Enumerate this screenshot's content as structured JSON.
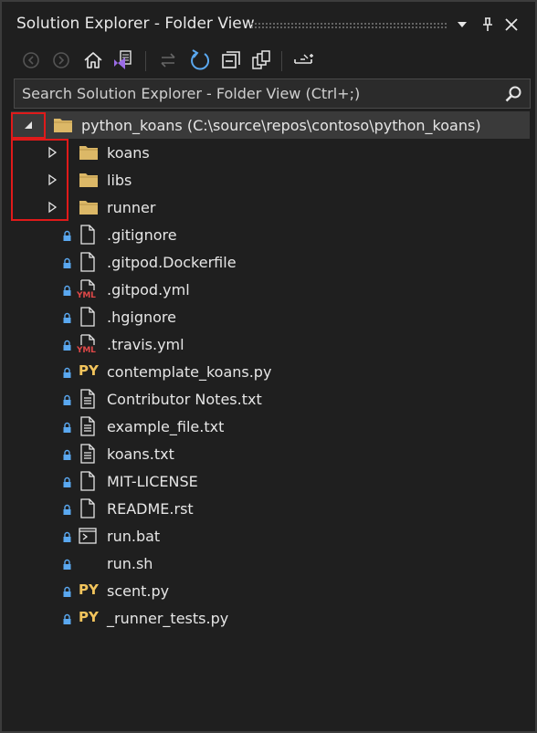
{
  "window": {
    "title": "Solution Explorer - Folder View"
  },
  "colors": {
    "accent_blue": "#5aa8f0",
    "folder": "#dcb867",
    "python": "#f2c45c",
    "yaml": "#e04848",
    "highlight": "#e01a1a"
  },
  "title_buttons": [
    {
      "name": "dropdown-icon"
    },
    {
      "name": "pin-icon"
    },
    {
      "name": "close-icon"
    }
  ],
  "toolbar": {
    "buttons": [
      "back-icon",
      "forward-icon",
      "home-icon",
      "switch-views-icon",
      "sync-icon",
      "refresh-icon",
      "collapse-all-icon",
      "show-all-files-icon",
      "properties-icon"
    ]
  },
  "search": {
    "placeholder": "Search Solution Explorer - Folder View (Ctrl+;)"
  },
  "tree": {
    "root": {
      "label": "python_koans (C:\\source\\repos\\contoso\\python_koans)",
      "expanded": true
    },
    "folders": [
      {
        "label": "koans"
      },
      {
        "label": "libs"
      },
      {
        "label": "runner"
      }
    ],
    "files": [
      {
        "label": ".gitignore",
        "icon": "file-icon"
      },
      {
        "label": ".gitpod.Dockerfile",
        "icon": "file-icon"
      },
      {
        "label": ".gitpod.yml",
        "icon": "yaml-file-icon",
        "tag": "YML"
      },
      {
        "label": ".hgignore",
        "icon": "file-icon"
      },
      {
        "label": ".travis.yml",
        "icon": "yaml-file-icon",
        "tag": "YML"
      },
      {
        "label": "contemplate_koans.py",
        "icon": "python-file-icon",
        "tag": "PY"
      },
      {
        "label": "Contributor Notes.txt",
        "icon": "text-file-icon"
      },
      {
        "label": "example_file.txt",
        "icon": "text-file-icon"
      },
      {
        "label": "koans.txt",
        "icon": "text-file-icon"
      },
      {
        "label": "MIT-LICENSE",
        "icon": "file-icon"
      },
      {
        "label": "README.rst",
        "icon": "file-icon"
      },
      {
        "label": "run.bat",
        "icon": "batch-file-icon"
      },
      {
        "label": "run.sh",
        "icon": "none"
      },
      {
        "label": "scent.py",
        "icon": "python-file-icon",
        "tag": "PY"
      },
      {
        "label": "_runner_tests.py",
        "icon": "python-file-icon",
        "tag": "PY"
      }
    ]
  }
}
